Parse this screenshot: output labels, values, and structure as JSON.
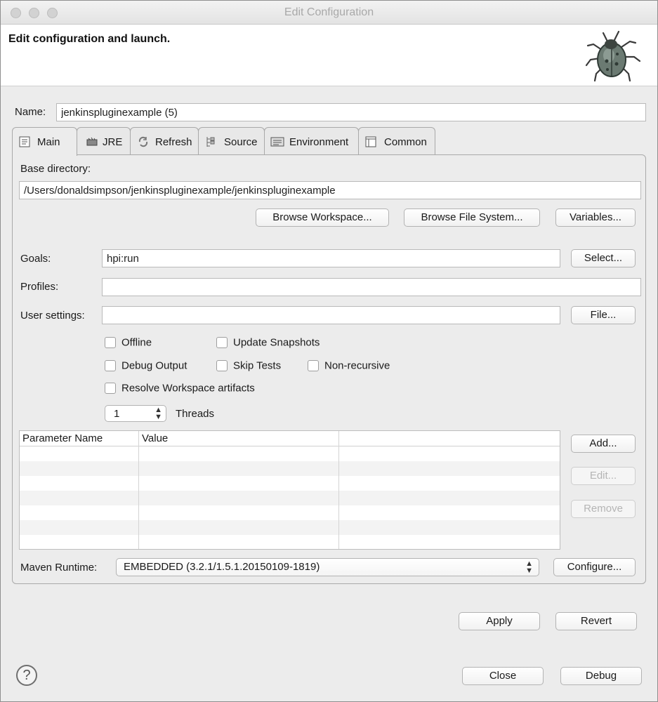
{
  "window": {
    "title": "Edit Configuration"
  },
  "header": {
    "title": "Edit configuration and launch.",
    "icon": "bug-icon"
  },
  "name": {
    "label": "Name:",
    "value": "jenkinspluginexample (5)"
  },
  "tabs": [
    {
      "label": "Main",
      "icon": "main-tab-icon"
    },
    {
      "label": "JRE",
      "icon": "jre-icon"
    },
    {
      "label": "Refresh",
      "icon": "refresh-icon"
    },
    {
      "label": "Source",
      "icon": "source-icon"
    },
    {
      "label": "Environment",
      "icon": "environment-icon"
    },
    {
      "label": "Common",
      "icon": "common-icon"
    }
  ],
  "main": {
    "base_directory_label": "Base directory:",
    "base_directory_value": "/Users/donaldsimpson/jenkinspluginexample/jenkinspluginexample",
    "browse_workspace": "Browse Workspace...",
    "browse_file_system": "Browse File System...",
    "variables": "Variables...",
    "goals_label": "Goals:",
    "goals_value": "hpi:run",
    "select_button": "Select...",
    "profiles_label": "Profiles:",
    "profiles_value": "",
    "user_settings_label": "User settings:",
    "user_settings_value": "",
    "file_button": "File...",
    "checkboxes": {
      "offline": "Offline",
      "update_snapshots": "Update Snapshots",
      "debug_output": "Debug Output",
      "skip_tests": "Skip Tests",
      "non_recursive": "Non-recursive",
      "resolve_workspace": "Resolve Workspace artifacts"
    },
    "threads_value": "1",
    "threads_label": "Threads",
    "params_table": {
      "columns": [
        "Parameter Name",
        "Value",
        ""
      ],
      "rows": []
    },
    "add_button": "Add...",
    "edit_button": "Edit...",
    "remove_button": "Remove",
    "maven_runtime_label": "Maven Runtime:",
    "maven_runtime_value": "EMBEDDED (3.2.1/1.5.1.20150109-1819)",
    "configure_button": "Configure..."
  },
  "footer": {
    "apply": "Apply",
    "revert": "Revert",
    "close": "Close",
    "debug": "Debug",
    "help_icon": "?"
  }
}
